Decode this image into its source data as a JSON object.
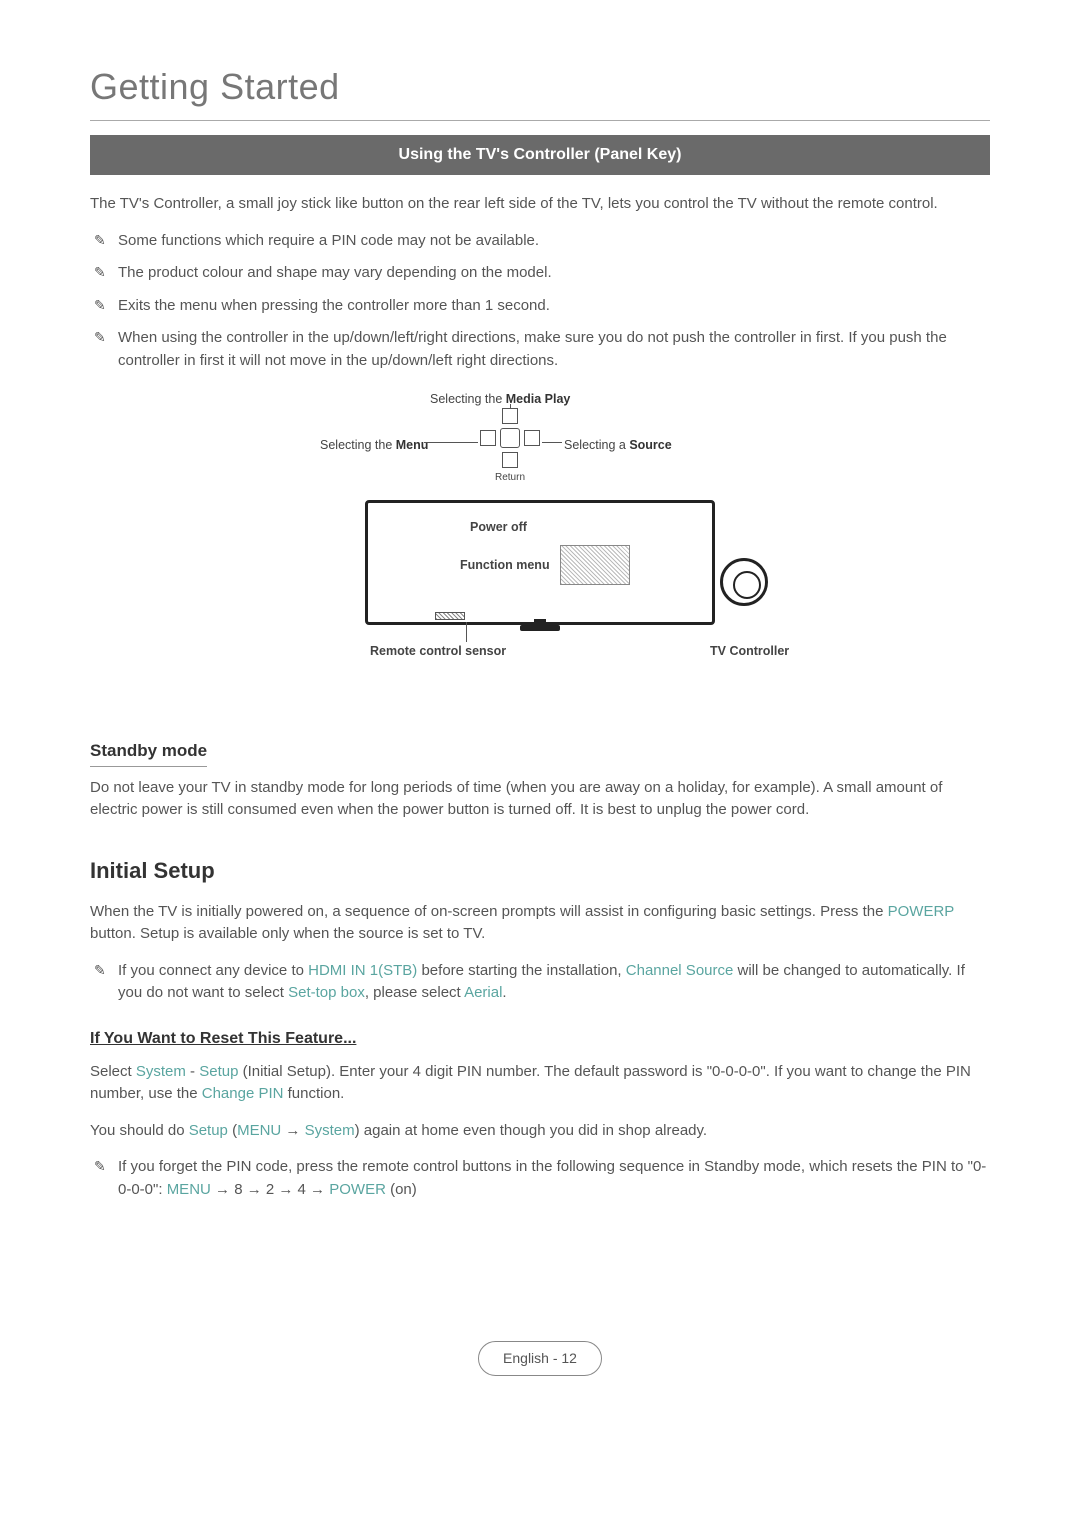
{
  "chapter": "Getting Started",
  "sectionBar": "Using the TV's Controller (Panel Key)",
  "intro": "The TV's Controller, a small joy stick like button on the rear left side of the TV, lets you control the TV without the remote control.",
  "notes": [
    "Some functions which require a PIN code may not be available.",
    "The product colour and shape may vary depending on the model.",
    "Exits the menu when pressing the controller more than 1 second.",
    "When using the controller in the up/down/left/right directions, make sure you do not push the controller in first. If you push the controller in first it will not move in the up/down/left right directions."
  ],
  "diagram": {
    "mediaPlay_prefix": "Selecting the ",
    "mediaPlay_bold": "Media Play",
    "menu_prefix": "Selecting the ",
    "menu_bold": "Menu",
    "source_prefix": "Selecting a ",
    "source_bold": "Source",
    "return": "Return",
    "powerOff": "Power off",
    "functionMenu": "Function menu",
    "remoteSensor": "Remote control sensor",
    "tvController": "TV Controller"
  },
  "standby": {
    "heading": "Standby mode",
    "text": "Do not leave your TV in standby mode for long periods of time (when you are away on a holiday, for example). A small amount of electric power is still consumed even when the power button is turned off. It is best to unplug the power cord."
  },
  "initialSetup": {
    "heading": "Initial Setup",
    "p1_a": "When the TV is initially powered on, a sequence of on-screen prompts will assist in configuring basic settings. Press the ",
    "p1_power": "POWER",
    "p1_powerSym": "P",
    "p1_b": " button. Setup is available only when the source is set to TV.",
    "note_a": "If you connect any device to ",
    "note_hdmi": "HDMI IN 1(STB)",
    "note_b": " before starting the installation, ",
    "note_channel": "Channel Source",
    "note_c": " will be changed to automatically. If you do not want to select ",
    "note_stb": "Set-top box",
    "note_d": ", please select ",
    "note_aerial": "Aerial",
    "note_e": "."
  },
  "reset": {
    "heading": "If You Want to Reset This Feature...",
    "p1_a": "Select ",
    "p1_system": "System",
    "p1_dash": " - ",
    "p1_setup": "Setup",
    "p1_b": " (Initial Setup). Enter your 4 digit PIN number. The default password is \"0-0-0-0\". If you want to change the PIN number, use the ",
    "p1_changePin": "Change PIN",
    "p1_c": " function.",
    "p2_a": "You should do ",
    "p2_setup": "Setup",
    "p2_b": " (",
    "p2_menu": "MENU",
    "p2_arrow": " → ",
    "p2_system": "System",
    "p2_c": ") again at home even though you did in shop already.",
    "note_a": "If you forget the PIN code, press the remote control buttons in the following sequence in Standby mode, which resets the PIN to \"0-0-0-0\": ",
    "note_menu": "MENU",
    "note_seq": " → 8 → 2 → 4 → ",
    "note_power": "POWER",
    "note_b": " (on)"
  },
  "footer": "English - 12"
}
